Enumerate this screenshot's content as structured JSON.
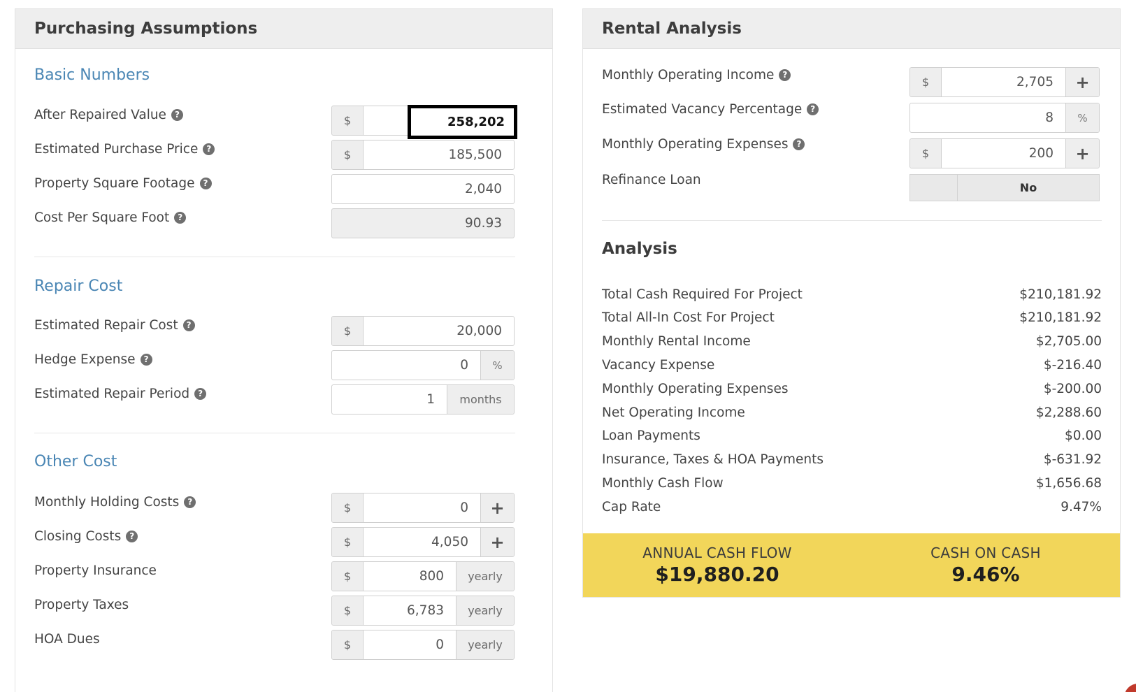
{
  "purchasing": {
    "title": "Purchasing Assumptions",
    "basic": {
      "title": "Basic Numbers",
      "after_repaired_value": {
        "label": "After Repaired Value",
        "prefix": "$",
        "value": "258,202"
      },
      "purchase_price": {
        "label": "Estimated Purchase Price",
        "prefix": "$",
        "value": "185,500"
      },
      "square_footage": {
        "label": "Property Square Footage",
        "value": "2,040"
      },
      "cost_per_sqft": {
        "label": "Cost Per Square Foot",
        "value": "90.93"
      }
    },
    "repair": {
      "title": "Repair Cost",
      "repair_cost": {
        "label": "Estimated Repair Cost",
        "prefix": "$",
        "value": "20,000"
      },
      "hedge_expense": {
        "label": "Hedge Expense",
        "value": "0",
        "suffix": "%"
      },
      "repair_period": {
        "label": "Estimated Repair Period",
        "value": "1",
        "suffix": "months"
      }
    },
    "other": {
      "title": "Other Cost",
      "holding_costs": {
        "label": "Monthly Holding Costs",
        "prefix": "$",
        "value": "0",
        "action": "+"
      },
      "closing_costs": {
        "label": "Closing Costs",
        "prefix": "$",
        "value": "4,050",
        "action": "+"
      },
      "insurance": {
        "label": "Property Insurance",
        "prefix": "$",
        "value": "800",
        "suffix": "yearly"
      },
      "taxes": {
        "label": "Property Taxes",
        "prefix": "$",
        "value": "6,783",
        "suffix": "yearly"
      },
      "hoa": {
        "label": "HOA Dues",
        "prefix": "$",
        "value": "0",
        "suffix": "yearly"
      }
    }
  },
  "rental": {
    "title": "Rental Analysis",
    "operating_income": {
      "label": "Monthly Operating Income",
      "prefix": "$",
      "value": "2,705",
      "action": "+"
    },
    "vacancy": {
      "label": "Estimated Vacancy Percentage",
      "value": "8",
      "suffix": "%"
    },
    "operating_expenses": {
      "label": "Monthly Operating Expenses",
      "prefix": "$",
      "value": "200",
      "action": "+"
    },
    "refinance": {
      "label": "Refinance Loan",
      "value": "No"
    },
    "analysis": {
      "title": "Analysis",
      "rows": [
        {
          "label": "Total Cash Required For Project",
          "value": "$210,181.92"
        },
        {
          "label": "Total All-In Cost For Project",
          "value": "$210,181.92"
        },
        {
          "label": "Monthly Rental Income",
          "value": "$2,705.00"
        },
        {
          "label": "Vacancy Expense",
          "value": "$-216.40"
        },
        {
          "label": "Monthly Operating Expenses",
          "value": "$-200.00"
        },
        {
          "label": "Net Operating Income",
          "value": "$2,288.60"
        },
        {
          "label": "Loan Payments",
          "value": "$0.00"
        },
        {
          "label": "Insurance, Taxes & HOA Payments",
          "value": "$-631.92"
        },
        {
          "label": "Monthly Cash Flow",
          "value": "$1,656.68"
        },
        {
          "label": "Cap Rate",
          "value": "9.47%"
        }
      ]
    },
    "summary": {
      "annual_cash_flow_label": "ANNUAL CASH FLOW",
      "annual_cash_flow_value": "$19,880.20",
      "cash_on_cash_label": "CASH ON CASH",
      "cash_on_cash_value": "9.46%"
    }
  },
  "colors": {
    "section_title": "#4a86b4",
    "summary_bg": "#f2d65a",
    "header_bg": "#eeeeee"
  },
  "icons": {
    "help": "question-circle-icon",
    "plus": "plus-icon"
  }
}
